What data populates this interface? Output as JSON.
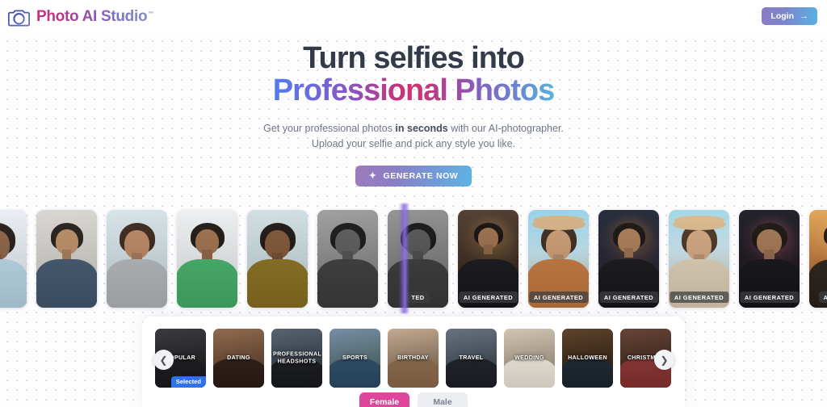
{
  "header": {
    "logo_icon": "camera-aperture-icon",
    "brand_name": "Photo AI Studio",
    "brand_tm": "™",
    "login_label": "Login",
    "login_arrow_icon": "arrow-right-icon"
  },
  "hero": {
    "headline_line1": "Turn selfies into",
    "headline_line2": "Professional Photos",
    "sub_part1": "Get your professional photos ",
    "sub_emphasis": "in seconds",
    "sub_part2": " with our AI-photographer.",
    "sub_line2": "Upload your selfie and pick any style you like.",
    "cta_label": "GENERATE NOW",
    "cta_icon": "magic-wand-icon"
  },
  "photo_strip": {
    "ai_label": "AI GENERATED",
    "truncated_ai_label": "TED",
    "cards": [
      {
        "id": "real-1",
        "kind": "real",
        "label": ""
      },
      {
        "id": "real-2",
        "kind": "real",
        "label": ""
      },
      {
        "id": "real-3",
        "kind": "real",
        "label": ""
      },
      {
        "id": "real-4",
        "kind": "real",
        "label": ""
      },
      {
        "id": "real-5",
        "kind": "real",
        "label": ""
      },
      {
        "id": "real-6",
        "kind": "real",
        "label": ""
      },
      {
        "id": "real-7",
        "kind": "real",
        "label": "TED"
      },
      {
        "id": "ai-1",
        "kind": "ai",
        "label": "AI GENERATED"
      },
      {
        "id": "ai-2",
        "kind": "ai",
        "label": "AI GENERATED"
      },
      {
        "id": "ai-3",
        "kind": "ai",
        "label": "AI GENERATED"
      },
      {
        "id": "ai-4",
        "kind": "ai",
        "label": "AI GENERATED"
      },
      {
        "id": "ai-5",
        "kind": "ai",
        "label": "AI GENERATED"
      },
      {
        "id": "ai-6",
        "kind": "ai",
        "label": "AI GENER"
      }
    ]
  },
  "style_panel": {
    "prev_icon": "chevron-left-icon",
    "next_icon": "chevron-right-icon",
    "selected_badge": "Selected",
    "styles": [
      {
        "label": "POPULAR",
        "selected": true
      },
      {
        "label": "DATING",
        "selected": false
      },
      {
        "label": "PROFESSIONAL HEADSHOTS",
        "selected": false
      },
      {
        "label": "SPORTS",
        "selected": false
      },
      {
        "label": "BIRTHDAY",
        "selected": false
      },
      {
        "label": "TRAVEL",
        "selected": false
      },
      {
        "label": "WEDDING",
        "selected": false
      },
      {
        "label": "HALLOWEEN",
        "selected": false
      },
      {
        "label": "CHRISTMAS",
        "selected": false
      }
    ],
    "gender": {
      "female_label": "Female",
      "male_label": "Male",
      "selected": "Female"
    }
  },
  "colors": {
    "accent_blue": "#2f72f0",
    "accent_pink": "#e0459c",
    "headline_dark": "#343b48",
    "split_purple": "#7c5cd6"
  }
}
